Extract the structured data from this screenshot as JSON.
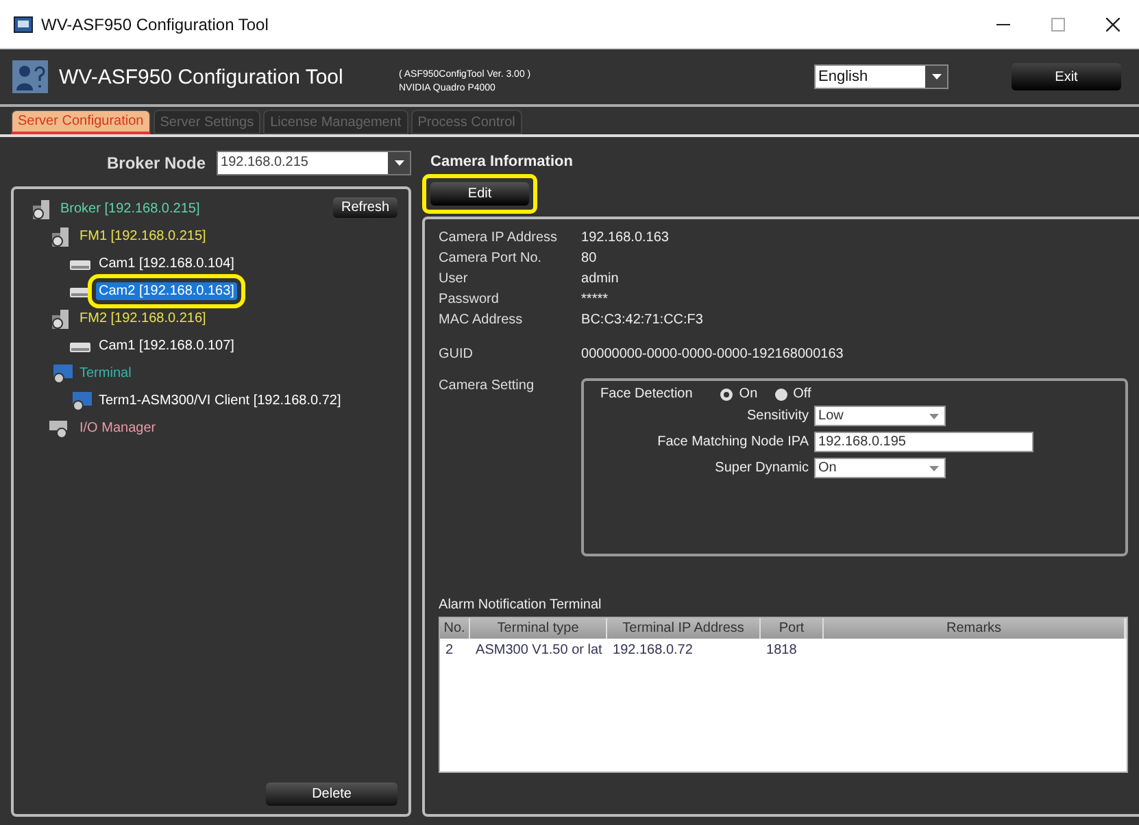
{
  "window": {
    "title": "WV-ASF950 Configuration Tool"
  },
  "header": {
    "title": "WV-ASF950 Configuration Tool",
    "version": "( ASF950ConfigTool Ver. 3.00 )",
    "gpu": "NVIDIA Quadro P4000",
    "language": "English",
    "exit": "Exit"
  },
  "tabs": [
    {
      "label": "Server Configuration",
      "selected": true
    },
    {
      "label": "Server Settings",
      "selected": false
    },
    {
      "label": "License Management",
      "selected": false
    },
    {
      "label": "Process Control",
      "selected": false
    }
  ],
  "broker_node": {
    "label": "Broker Node",
    "value": "192.168.0.215"
  },
  "tree": {
    "refresh": "Refresh",
    "delete": "Delete",
    "nodes": [
      {
        "kind": "broker",
        "label": "Broker [192.168.0.215]",
        "selected": false,
        "children": [
          {
            "kind": "fm",
            "label": "FM1 [192.168.0.215]",
            "selected": false,
            "children": [
              {
                "kind": "camera",
                "label": "Cam1 [192.168.0.104]",
                "selected": false
              },
              {
                "kind": "camera",
                "label": "Cam2 [192.168.0.163]",
                "selected": true,
                "highlighted": true
              }
            ]
          },
          {
            "kind": "fm",
            "label": "FM2 [192.168.0.216]",
            "selected": false,
            "children": [
              {
                "kind": "camera",
                "label": "Cam1 [192.168.0.107]",
                "selected": false
              }
            ]
          },
          {
            "kind": "terminal",
            "label": "Terminal",
            "selected": false,
            "children": [
              {
                "kind": "terminal-item",
                "label": "Term1-ASM300/VI Client [192.168.0.72]",
                "selected": false
              }
            ]
          },
          {
            "kind": "io",
            "label": "I/O Manager",
            "selected": false
          }
        ]
      }
    ]
  },
  "camera_information": {
    "title": "Camera Information",
    "edit": "Edit",
    "edit_highlighted": true,
    "fields": [
      {
        "label": "Camera IP Address",
        "value": "192.168.0.163"
      },
      {
        "label": "Camera Port No.",
        "value": "80"
      },
      {
        "label": "User",
        "value": "admin"
      },
      {
        "label": "Password",
        "value": "*****"
      },
      {
        "label": "MAC Address",
        "value": "BC:C3:42:71:CC:F3"
      },
      {
        "label": "GUID",
        "value": "00000000-0000-0000-0000-192168000163"
      }
    ],
    "camera_setting": {
      "label": "Camera Setting",
      "face_detection": {
        "label": "Face Detection",
        "options": [
          {
            "label": "On",
            "selected": true
          },
          {
            "label": "Off",
            "selected": false
          }
        ]
      },
      "sensitivity": {
        "label": "Sensitivity",
        "value": "Low"
      },
      "face_matching_node_ipa": {
        "label": "Face Matching Node IPA",
        "value": "192.168.0.195"
      },
      "super_dynamic": {
        "label": "Super Dynamic",
        "value": "On"
      }
    },
    "alarm_notification_terminal": {
      "title": "Alarm Notification Terminal",
      "columns": [
        "No.",
        "Terminal type",
        "Terminal IP Address",
        "Port",
        "Remarks"
      ],
      "rows": [
        [
          "2",
          "ASM300 V1.50 or lat",
          "192.168.0.72",
          "1818",
          ""
        ]
      ]
    }
  }
}
